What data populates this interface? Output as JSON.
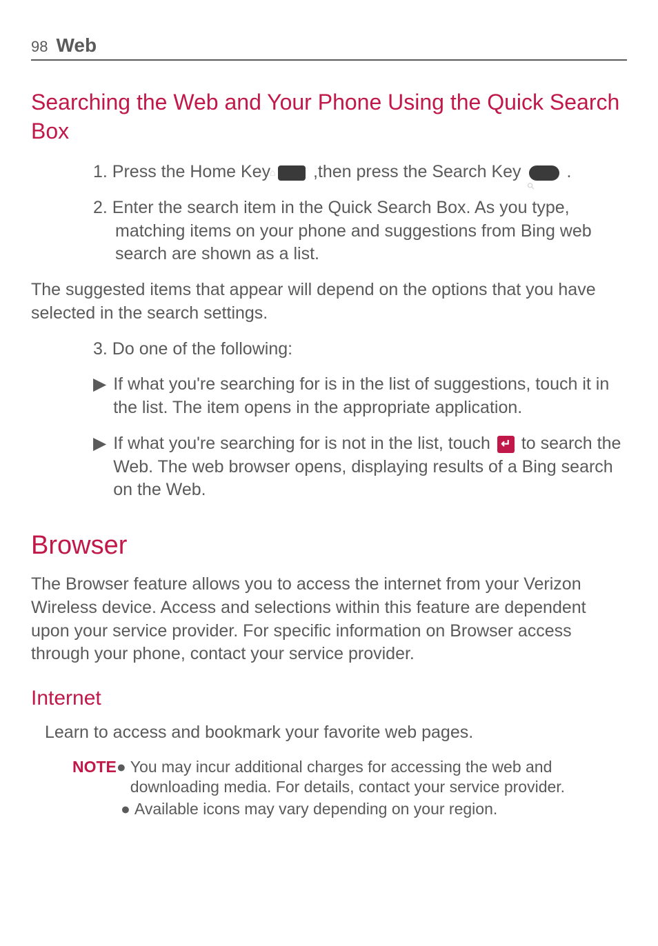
{
  "header": {
    "page_number": "98",
    "section": "Web"
  },
  "heading1": "Searching the Web and Your Phone Using the Quick Search Box",
  "step1_pre": "1. Press the ",
  "step1_key1": "Home Key ",
  "step1_mid": " ,then press the ",
  "step1_key2": "Search Key ",
  "step1_end": " .",
  "step2": "2. Enter the search item in the Quick Search Box. As you type, matching items on your phone and suggestions from Bing web search are shown as a list.",
  "para1": "The suggested items that appear will depend on the options that you have selected in the search settings.",
  "step3": "3. Do one of the following:",
  "bullet1": "If what you're searching for is in the list of suggestions, touch it in the list. The item opens in the appropriate application.",
  "bullet2_pre": "If what you're searching for is not in the list, touch ",
  "bullet2_post": " to search the Web. The web browser opens, displaying results of a Bing search on the Web.",
  "heading2": "Browser",
  "para2": "The Browser feature allows you to access the internet from your Verizon Wireless device. Access and selections within this feature are dependent upon your service provider. For specific information on Browser access through your phone, contact your service provider.",
  "heading3": "Internet",
  "para3": "Learn to access and bookmark your favorite web pages.",
  "note_label": "NOTE",
  "note1": "You may incur additional charges for accessing the web and downloading media. For details, contact your service provider.",
  "note2": "Available icons may vary depending on your region."
}
